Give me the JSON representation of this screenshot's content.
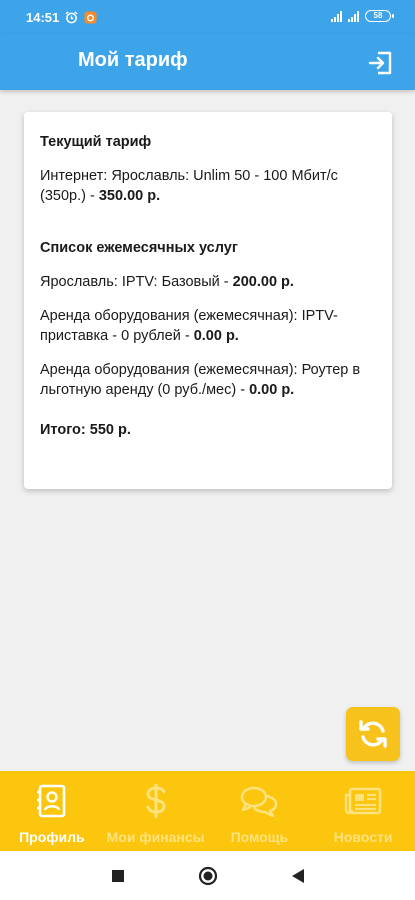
{
  "status_bar": {
    "time": "14:51",
    "battery": "58"
  },
  "app_bar": {
    "title": "Мой тариф"
  },
  "card": {
    "current_tariff_heading": "Текущий тариф",
    "current_tariff_text": "Интернет: Ярославль: Unlim 50 - 100 Мбит/с (350р.) - ",
    "current_tariff_amount": "350.00 р.",
    "services_heading": "Список ежемесячных услуг",
    "services": [
      {
        "text": "Ярославль: IPTV: Базовый - ",
        "amount": "200.00 р."
      },
      {
        "text": "Аренда оборудования (ежемесячная): IPTV-приставка - 0 рублей  - ",
        "amount": "0.00 р."
      },
      {
        "text": "Аренда оборудования (ежемесячная): Роутер в льготную аренду (0 руб./мес) - ",
        "amount": "0.00 р."
      }
    ],
    "total": "Итого: 550 р."
  },
  "bottom_nav": {
    "items": [
      {
        "label": "Профиль",
        "icon": "profile-icon",
        "active": true
      },
      {
        "label": "Мои финансы",
        "icon": "dollar-icon",
        "active": false
      },
      {
        "label": "Помощь",
        "icon": "chat-icon",
        "active": false
      },
      {
        "label": "Новости",
        "icon": "news-icon",
        "active": false
      }
    ]
  },
  "colors": {
    "app_bar": "#3da4ea",
    "bottom_nav": "#fcc50e",
    "fab": "#f7c21b",
    "active_label": "#ffffff",
    "inactive_label": "#fde27e"
  }
}
